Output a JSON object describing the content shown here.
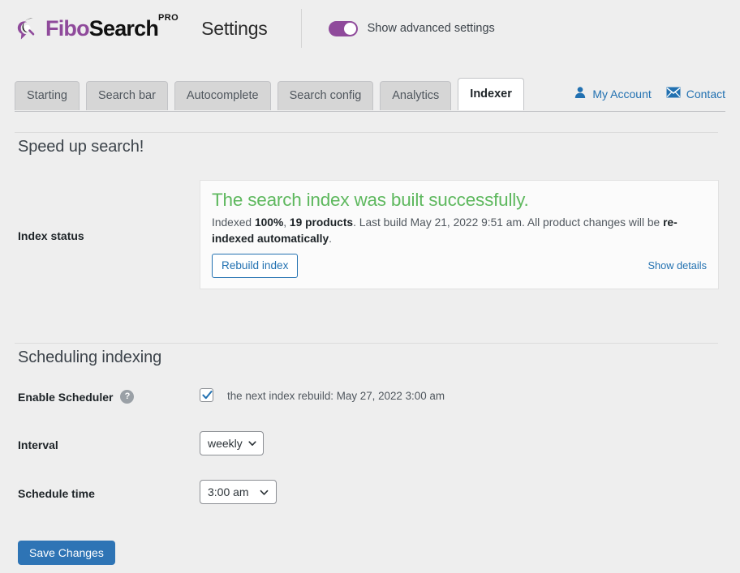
{
  "header": {
    "logo_icon": "fibosearch-speech-bubble-magnifier-logo",
    "brand_part1": "Fibo",
    "brand_part2": "Search",
    "brand_superscript": "PRO",
    "page_title": "Settings",
    "advanced_toggle_label": "Show advanced settings",
    "advanced_toggle_state": "on",
    "brand_color": "#8f4a9b"
  },
  "tabs": {
    "items": [
      {
        "label": "Starting",
        "active": false
      },
      {
        "label": "Search bar",
        "active": false
      },
      {
        "label": "Autocomplete",
        "active": false
      },
      {
        "label": "Search config",
        "active": false
      },
      {
        "label": "Analytics",
        "active": false
      },
      {
        "label": "Indexer",
        "active": true
      }
    ],
    "links": [
      {
        "label": "My Account",
        "icon": "user-icon"
      },
      {
        "label": "Contact",
        "icon": "envelope-icon"
      }
    ],
    "link_color": "#2271b1"
  },
  "speed_section": {
    "title": "Speed up search!",
    "index_status_label": "Index status",
    "status": {
      "headline": "The search index was built successfully.",
      "headline_color": "#5eb85e",
      "desc_prefix": "Indexed ",
      "percent": "100%",
      "desc_sep1": ", ",
      "products": "19 products",
      "desc_mid": ". Last build May 21, 2022 9:51 am. All product changes will be ",
      "reindexed": "re-indexed automatically",
      "desc_suffix": ".",
      "rebuild_button": "Rebuild index",
      "show_details_link": "Show details"
    }
  },
  "scheduling_section": {
    "title": "Scheduling indexing",
    "enable_scheduler_label": "Enable Scheduler",
    "help_icon_glyph": "?",
    "scheduler_checked": true,
    "next_rebuild_note": "the next index rebuild: May 27, 2022 3:00 am",
    "interval_label": "Interval",
    "interval_value": "weekly",
    "schedule_time_label": "Schedule time",
    "schedule_time_value": "3:00 am"
  },
  "footer": {
    "save_label": "Save Changes",
    "save_color": "#2e74b5"
  }
}
